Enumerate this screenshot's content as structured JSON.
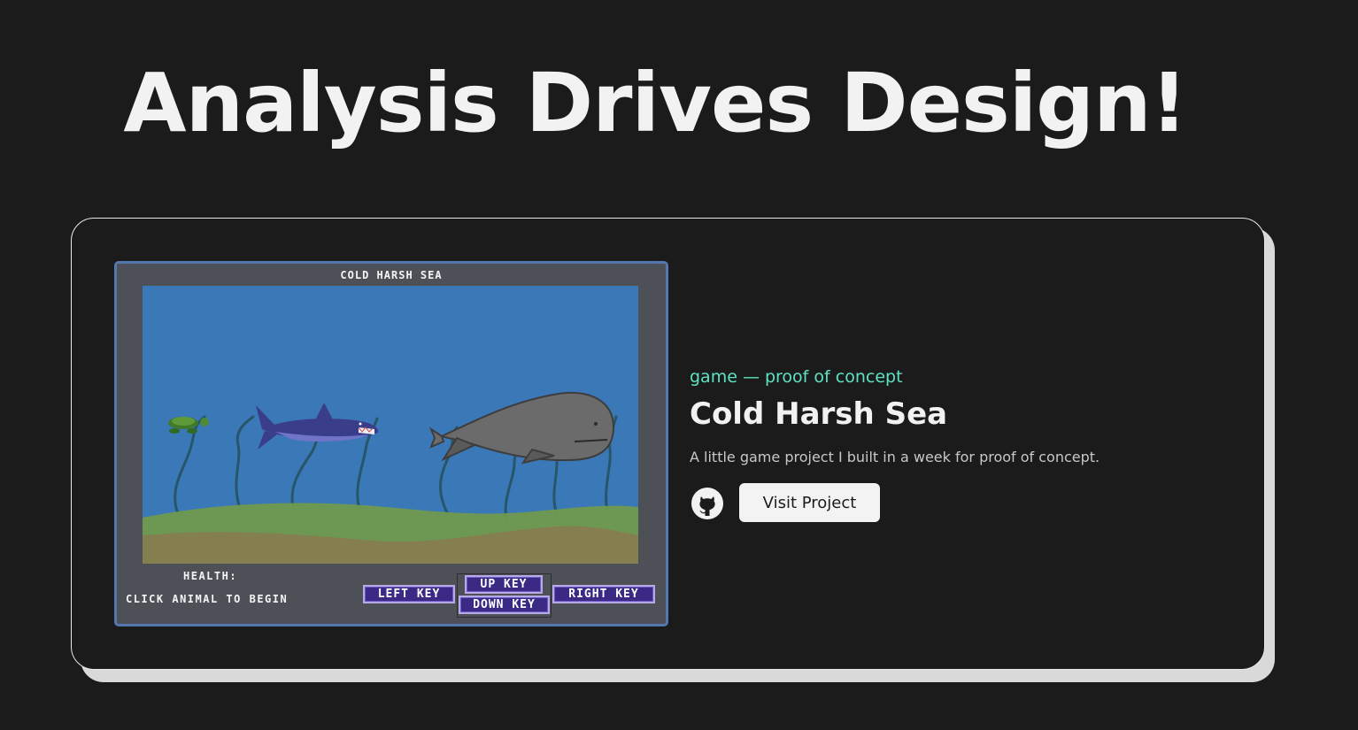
{
  "page": {
    "heading": "Analysis Drives Design!"
  },
  "project": {
    "category": "game — proof of concept",
    "title": "Cold Harsh Sea",
    "description": "A little game project I built in a week for proof of concept.",
    "visit_label": "Visit Project",
    "github_icon": "github-icon"
  },
  "game": {
    "title": "COLD HARSH SEA",
    "health_label": "HEALTH:",
    "start_prompt": "CLICK ANIMAL TO BEGIN",
    "keys": {
      "left": "LEFT KEY",
      "up": "UP KEY",
      "down": "DOWN KEY",
      "right": "RIGHT KEY"
    },
    "animals": [
      "turtle",
      "shark",
      "whale"
    ]
  },
  "colors": {
    "background": "#1b1b1b",
    "accent": "#5ee3c0",
    "frame_border": "#5577b0",
    "sea": "#3b78b7",
    "key_button": "#3a2a86"
  }
}
